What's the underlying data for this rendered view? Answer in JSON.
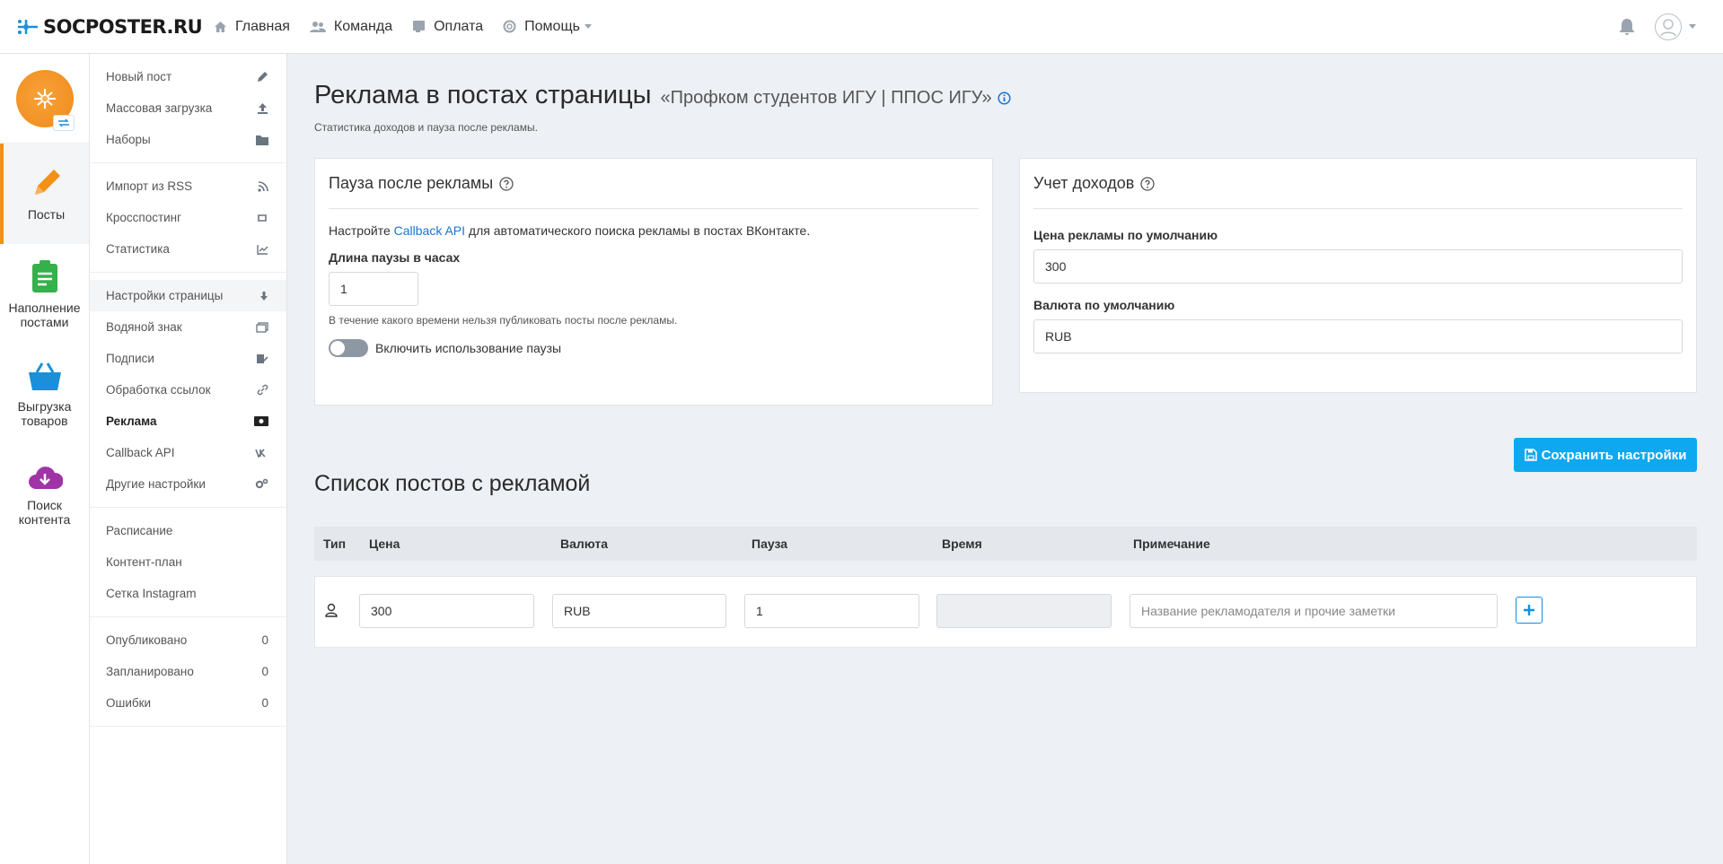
{
  "brand": {
    "name": "SOCPOSTER.RU"
  },
  "nav": {
    "home": "Главная",
    "team": "Команда",
    "payment": "Оплата",
    "help": "Помощь"
  },
  "iconbar": {
    "posts": "Посты",
    "content": "Наполнение постами",
    "goods": "Выгрузка товаров",
    "search": "Поиск контента"
  },
  "submenu": {
    "group1": [
      "Новый пост",
      "Массовая загрузка",
      "Наборы"
    ],
    "group2": [
      "Импорт из RSS",
      "Кросспостинг",
      "Статистика"
    ],
    "group3": [
      "Настройки страницы",
      "Водяной знак",
      "Подписи",
      "Обработка ссылок",
      "Реклама",
      "Callback API",
      "Другие настройки"
    ],
    "group4": [
      "Расписание",
      "Контент-план",
      "Сетка Instagram"
    ],
    "group5": [
      {
        "label": "Опубликовано",
        "count": "0"
      },
      {
        "label": "Запланировано",
        "count": "0"
      },
      {
        "label": "Ошибки",
        "count": "0"
      }
    ]
  },
  "page": {
    "title": "Реклама в постах страницы",
    "group_name": "«Профком студентов ИГУ | ППОС ИГУ»",
    "subtitle": "Статистика доходов и пауза после рекламы."
  },
  "pause_card": {
    "title": "Пауза после рекламы",
    "text_before": "Настройте",
    "link": "Callback API",
    "text_after": "для автоматического поиска рекламы в постах ВКонтакте.",
    "length_label": "Длина паузы в часах",
    "length_value": "1",
    "hint": "В течение какого времени нельзя публиковать посты после рекламы.",
    "toggle_label": "Включить использование паузы"
  },
  "income_card": {
    "title": "Учет доходов",
    "price_label": "Цена рекламы по умолчанию",
    "price_value": "300",
    "currency_label": "Валюта по умолчанию",
    "currency_value": "RUB"
  },
  "save_button": "Сохранить настройки",
  "list": {
    "title": "Список постов с рекламой",
    "columns": [
      "Тип",
      "Цена",
      "Валюта",
      "Пауза",
      "Время",
      "Примечание"
    ],
    "row": {
      "price": "300",
      "currency": "RUB",
      "pause": "1",
      "time": "",
      "note_placeholder": "Название рекламодателя и прочие заметки"
    }
  },
  "colors": {
    "accent": "#0ea8f0",
    "active": "#f39018",
    "link": "#1875d1"
  }
}
